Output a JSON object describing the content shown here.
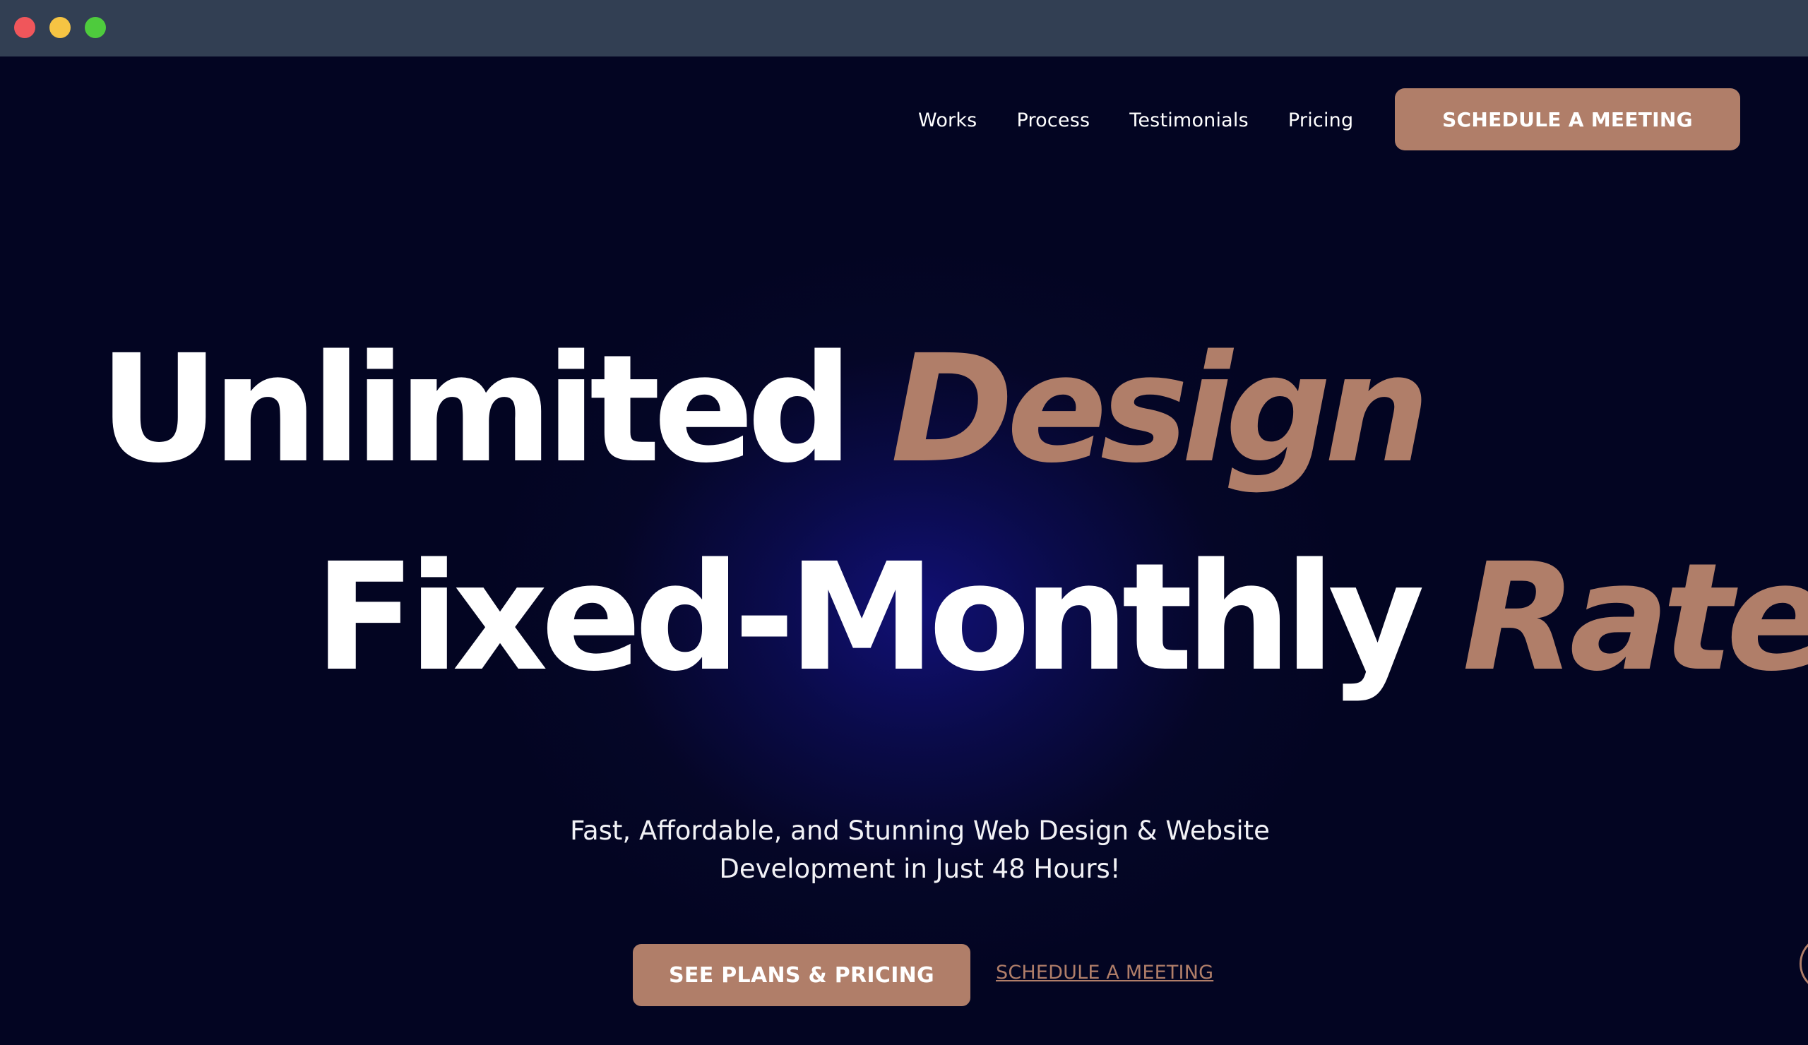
{
  "window": {
    "controls": [
      "close",
      "minimize",
      "maximize"
    ]
  },
  "nav": {
    "links": [
      "Works",
      "Process",
      "Testimonials",
      "Pricing"
    ],
    "cta_label": "SCHEDULE A MEETING"
  },
  "hero": {
    "line1_main": "Unlimited",
    "line1_accent": "Design",
    "line2_main": "Fixed-Monthly",
    "line2_accent": "Rate",
    "subtitle_line1": "Fast, Affordable, and Stunning Web Design & Website",
    "subtitle_line2": "Development in Just 48 Hours!",
    "primary_button": "SEE PLANS & PRICING",
    "secondary_link": "SCHEDULE A MEETING"
  },
  "colors": {
    "accent": "#b07e69",
    "background": "#030522",
    "glow": "#111075",
    "titlebar": "#323f53"
  }
}
